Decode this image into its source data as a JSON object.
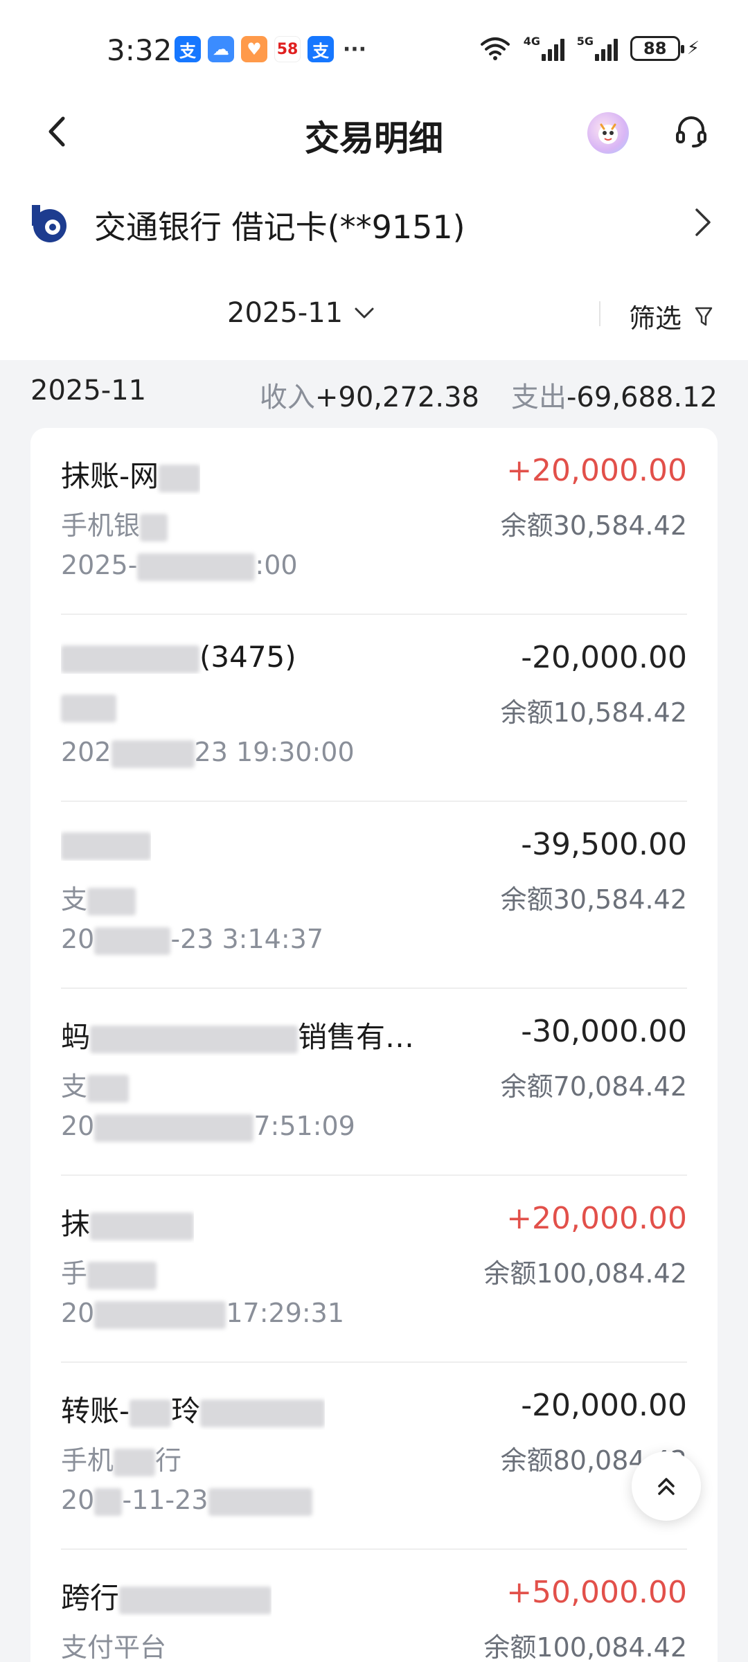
{
  "status_bar": {
    "time": "3:32",
    "notifications": [
      {
        "icon": "alipay-icon",
        "glyph": "支",
        "color": "#1677ff"
      },
      {
        "icon": "cloud-icon",
        "glyph": "☁",
        "color": "#3b8cff"
      },
      {
        "icon": "health-icon",
        "glyph": "♥",
        "color": "#ff9a4a"
      },
      {
        "icon": "58-app-icon",
        "glyph": "58",
        "color": "#ffffff"
      },
      {
        "icon": "alipay-icon",
        "glyph": "支",
        "color": "#1677ff"
      },
      {
        "icon": "more-icon",
        "glyph": "···",
        "color": "transparent"
      }
    ],
    "signal_1": "4G",
    "signal_2": "5G",
    "battery": "88"
  },
  "header": {
    "title": "交易明细",
    "back_icon": "chevron-left-icon",
    "mascot_icon": "mascot-avatar-icon",
    "service_icon": "headset-icon"
  },
  "account": {
    "name": "交通银行 借记卡(**9151)",
    "logo_icon": "bank-logo-icon",
    "arrow_icon": "chevron-right-icon",
    "brand_color": "#1d3c8f"
  },
  "filter_bar": {
    "month": "2025-11",
    "filter_label": "筛选",
    "filter_icon": "funnel-icon"
  },
  "summary": {
    "month": "2025-11",
    "income_label": "收入",
    "income_value": "+90,272.38",
    "expense_label": "支出",
    "expense_value": "-69,688.12"
  },
  "colors": {
    "income": "#e2504a",
    "expense": "#222222"
  },
  "transactions": [
    {
      "name": "抹账-网",
      "amount": "+20,000.00",
      "type": "income",
      "channel": "手机银",
      "balance": "余额30,584.42",
      "time": "2025-",
      "time_tail": ":00"
    },
    {
      "name": "(",
      "name_tail": "3475)",
      "amount": "-20,000.00",
      "type": "expense",
      "channel": "",
      "balance": "余额10,584.42",
      "time": "202",
      "time_tail": "23 19:30:00"
    },
    {
      "name": "",
      "amount": "-39,500.00",
      "type": "expense",
      "channel": "支",
      "balance": "余额30,584.42",
      "time": "20",
      "time_tail": "-23 3:14:37"
    },
    {
      "name": "蚂",
      "name_tail": "销售有…",
      "amount": "-30,000.00",
      "type": "expense",
      "channel": "支",
      "balance": "余额70,084.42",
      "time": "20",
      "time_tail": "7:51:09"
    },
    {
      "name": "抹",
      "amount": "+20,000.00",
      "type": "income",
      "channel": "手",
      "balance": "余额100,084.42",
      "time": "20",
      "time_tail": "17:29:31"
    },
    {
      "name": "转账-",
      "name_tail": "玲",
      "amount": "-20,000.00",
      "type": "expense",
      "channel": "手机",
      "channel_tail": "行",
      "balance": "余额80,084.42",
      "time": "20",
      "time_tail": "-11-23"
    },
    {
      "name": "跨行",
      "amount": "+50,000.00",
      "type": "income",
      "channel": "支付平台",
      "balance": "余额100,084.42",
      "time": "",
      "time_tail": ""
    }
  ],
  "scroll_top_icon": "double-chevron-up-icon"
}
